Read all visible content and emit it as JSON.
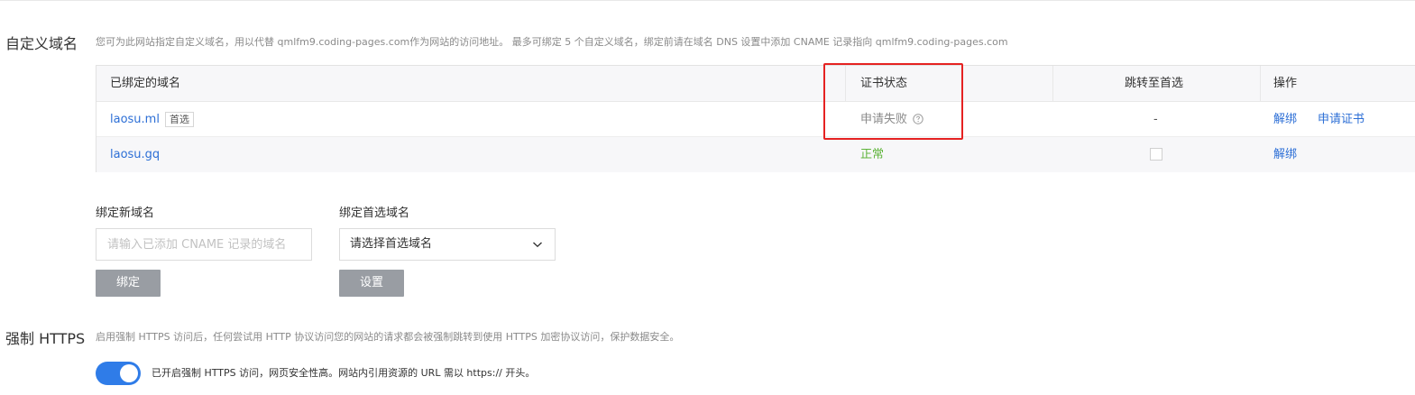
{
  "custom_domain": {
    "title": "自定义域名",
    "description": "您可为此网站指定自定义域名，用以代替 qmlfm9.coding-pages.com作为网站的访问地址。 最多可绑定 5 个自定义域名，绑定前请在域名 DNS 设置中添加 CNAME 记录指向 qmlfm9.coding-pages.com",
    "table": {
      "headers": {
        "domain": "已绑定的域名",
        "cert_status": "证书状态",
        "redirect": "跳转至首选",
        "actions": "操作"
      },
      "rows": [
        {
          "domain": "laosu.ml",
          "tag": "首选",
          "cert_status": "申请失败",
          "redirect": "-",
          "action_unbind": "解绑",
          "action_apply_cert": "申请证书"
        },
        {
          "domain": "laosu.gq",
          "cert_status": "正常",
          "action_unbind": "解绑"
        }
      ]
    },
    "bind_new": {
      "label": "绑定新域名",
      "placeholder": "请输入已添加 CNAME 记录的域名",
      "button": "绑定"
    },
    "bind_preferred": {
      "label": "绑定首选域名",
      "selected": "请选择首选域名",
      "button": "设置"
    }
  },
  "https": {
    "title": "强制 HTTPS",
    "description": "启用强制 HTTPS 访问后，任何尝试用 HTTP 协议访问您的网站的请求都会被强制跳转到使用 HTTPS 加密协议访问，保护数据安全。",
    "toggle_on": true,
    "toggle_text": "已开启强制 HTTPS 访问，网页安全性高。网站内引用资源的 URL 需以 https:// 开头。"
  },
  "colors": {
    "link": "#2d6fd6",
    "success": "#5fb43b",
    "highlight_box": "#e52222",
    "toggle_on": "#2f7ce8",
    "button_disabled": "#999da3"
  }
}
